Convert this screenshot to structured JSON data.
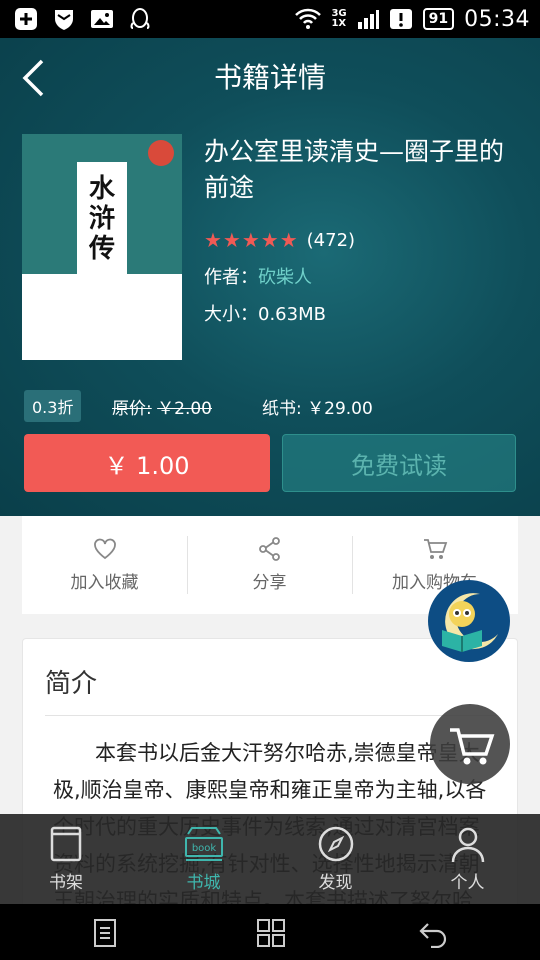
{
  "status_bar": {
    "time": "05:34",
    "battery": "91",
    "network_top": "3G",
    "network_bottom": "1X"
  },
  "header": {
    "title": "书籍详情"
  },
  "book": {
    "title": "办公室里读清史—圈子里的前途",
    "rating_count": "(472)",
    "stars": "★★★★★",
    "author_label": "作者：",
    "author": "砍柴人",
    "size_label": "大小：",
    "size": "0.63MB",
    "cover_calligraphy": "水浒传"
  },
  "pricing": {
    "discount": "0.3折",
    "original_label": "原价:",
    "original_price": "￥2.00",
    "paper_label": "纸书:",
    "paper_price": "￥29.00",
    "buy_label": "￥ 1.00",
    "trial_label": "免费试读"
  },
  "actions": {
    "favorite": "加入收藏",
    "share": "分享",
    "cart": "加入购物车"
  },
  "intro": {
    "heading": "简介",
    "text": "本套书以后金大汗努尔哈赤,崇德皇帝皇太极,顺治皇帝、康熙皇帝和雍正皇帝为主轴,以各个时代的重大历史事件为线索,通过对清宫档案资料的系统挖掘,有针对性、选择性地揭示清朝王朝治理的实质和特点。本套书描述了努尔哈赤"
  },
  "tabs": [
    {
      "label": "书架",
      "icon": "bookshelf-icon"
    },
    {
      "label": "书城",
      "icon": "bookstore-icon"
    },
    {
      "label": "发现",
      "icon": "compass-icon"
    },
    {
      "label": "个人",
      "icon": "person-icon"
    }
  ],
  "colors": {
    "accent": "#3fb6ad",
    "buy": "#f25a55",
    "hero": "#0f4e5a",
    "star": "#f05a55"
  }
}
